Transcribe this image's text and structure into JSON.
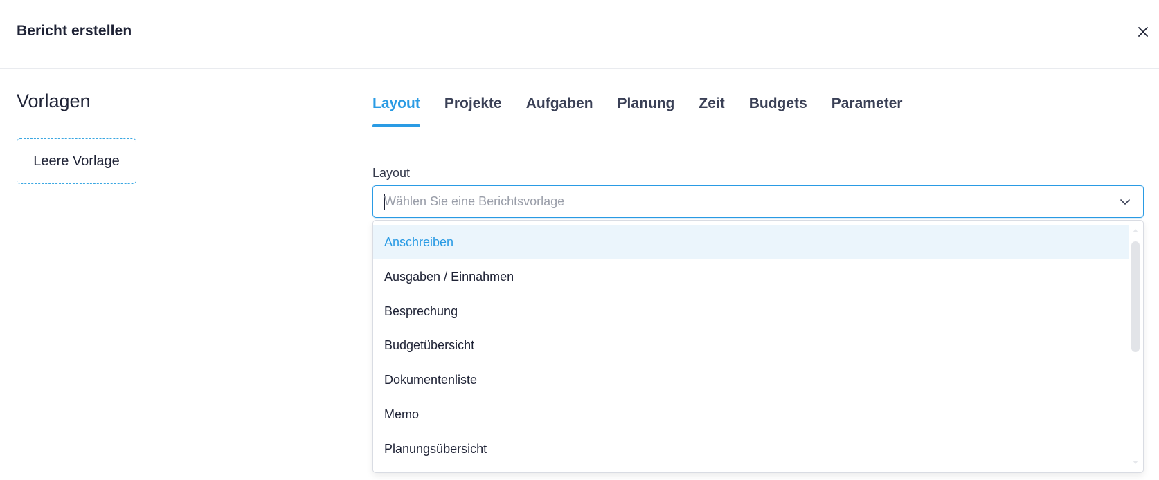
{
  "dialog": {
    "title": "Bericht erstellen",
    "close_icon": "close-icon"
  },
  "templates": {
    "heading": "Vorlagen",
    "items": [
      {
        "label": "Leere Vorlage"
      }
    ]
  },
  "tabs": [
    {
      "label": "Layout",
      "active": true
    },
    {
      "label": "Projekte",
      "active": false
    },
    {
      "label": "Aufgaben",
      "active": false
    },
    {
      "label": "Planung",
      "active": false
    },
    {
      "label": "Zeit",
      "active": false
    },
    {
      "label": "Budgets",
      "active": false
    },
    {
      "label": "Parameter",
      "active": false
    }
  ],
  "layout_field": {
    "label": "Layout",
    "value": "",
    "placeholder": "Wählen Sie eine Berichtsvorlage",
    "chevron_icon": "chevron-down-icon"
  },
  "dropdown": {
    "options": [
      {
        "label": "Anschreiben",
        "highlighted": true
      },
      {
        "label": "Ausgaben / Einnahmen",
        "highlighted": false
      },
      {
        "label": "Besprechung",
        "highlighted": false
      },
      {
        "label": "Budgetübersicht",
        "highlighted": false
      },
      {
        "label": "Dokumentenliste",
        "highlighted": false
      },
      {
        "label": "Memo",
        "highlighted": false
      },
      {
        "label": "Planungsübersicht",
        "highlighted": false
      }
    ]
  },
  "colors": {
    "accent": "#2a9be4",
    "highlight_bg": "#ebf5fc",
    "text": "#1e2235"
  }
}
